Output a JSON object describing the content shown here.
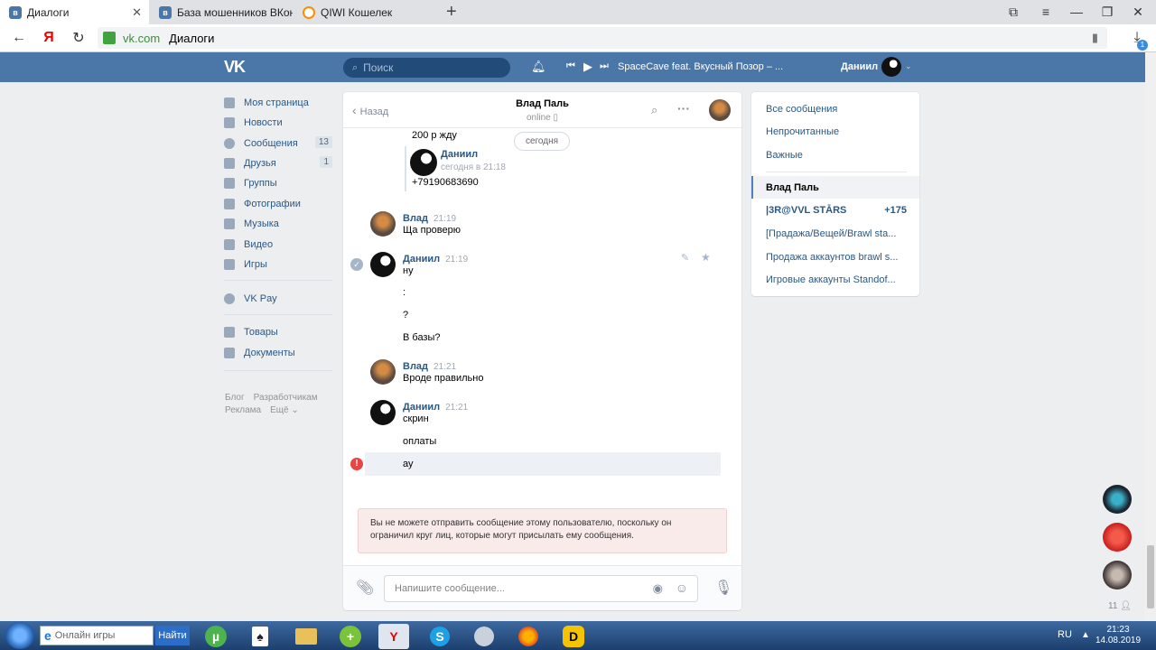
{
  "browser": {
    "tabs": [
      {
        "title": "Диалоги",
        "active": true,
        "favicon_color": "#4a76a8"
      },
      {
        "title": "База мошенников ВКонта",
        "active": false,
        "favicon_color": "#4a76a8"
      },
      {
        "title": "QIWI Кошелек",
        "active": false,
        "favicon_color": "#ff8c00"
      }
    ],
    "new_tab": "+",
    "url_host": "vk.com",
    "url_page": "Диалоги",
    "download_badge": "1"
  },
  "vk_header": {
    "logo": "VK",
    "search_placeholder": "Поиск",
    "now_playing": "SpaceCave feat. Вкусный Позор – ...",
    "user_name": "Даниил",
    "brand_color": "#4a76a8"
  },
  "left_menu": {
    "items": [
      {
        "label": "Моя страница",
        "icon": "home-icon",
        "count": ""
      },
      {
        "label": "Новости",
        "icon": "news-icon",
        "count": ""
      },
      {
        "label": "Сообщения",
        "icon": "messages-icon",
        "count": "13"
      },
      {
        "label": "Друзья",
        "icon": "friends-icon",
        "count": "1"
      },
      {
        "label": "Группы",
        "icon": "groups-icon",
        "count": ""
      },
      {
        "label": "Фотографии",
        "icon": "photos-icon",
        "count": ""
      },
      {
        "label": "Музыка",
        "icon": "music-icon",
        "count": ""
      },
      {
        "label": "Видео",
        "icon": "video-icon",
        "count": ""
      },
      {
        "label": "Игры",
        "icon": "games-icon",
        "count": ""
      }
    ],
    "vkpay": "VK Pay",
    "extra": [
      {
        "label": "Товары",
        "icon": "goods-icon"
      },
      {
        "label": "Документы",
        "icon": "documents-icon"
      }
    ],
    "footer": [
      "Блог",
      "Разработчикам",
      "Реклама",
      "Ещё ⌄"
    ]
  },
  "chat": {
    "back_label": "Назад",
    "peer_name": "Влад Паль",
    "peer_status": "online",
    "date_badge": "сегодня",
    "quoted_text": "200 р жду",
    "forwarded": {
      "name": "Даниил",
      "time": "сегодня в 21:18",
      "text": "+79190683690"
    },
    "groups": [
      {
        "name": "Влад",
        "time": "21:19",
        "lines": [
          "Ща проверю"
        ]
      },
      {
        "name": "Даниил",
        "time": "21:19",
        "lines": [
          "ну",
          ":",
          "?",
          "В базы?"
        ]
      },
      {
        "name": "Влад",
        "time": "21:21",
        "lines": [
          "Вроде правильно"
        ]
      },
      {
        "name": "Даниил",
        "time": "21:21",
        "lines": [
          "скрин",
          "оплаты",
          "ау"
        ]
      }
    ],
    "error_text": "Вы не можете отправить сообщение этому пользователю, поскольку он ограничил круг лиц, которые могут присылать ему сообщения.",
    "input_placeholder": "Напишите сообщение..."
  },
  "right_panel": {
    "filters": [
      "Все сообщения",
      "Непрочитанные",
      "Важные"
    ],
    "dialogs": [
      {
        "title": "Влад Паль",
        "count": "",
        "selected": true
      },
      {
        "title": "|3R@VVL STĀRS",
        "count": "+175",
        "selected": false
      },
      {
        "title": "[Прадажа/Вещей/Brawl sta...",
        "count": "",
        "selected": false
      },
      {
        "title": "Продажа аккаунтов brawl s...",
        "count": "",
        "selected": false
      },
      {
        "title": "Игровые аккаунты Standof...",
        "count": "",
        "selected": false
      }
    ]
  },
  "side_contacts": {
    "online_count": "11"
  },
  "taskbar": {
    "search_placeholder": "Онлайн игры",
    "search_button": "Найти",
    "lang": "RU",
    "time": "21:23",
    "date": "14.08.2019"
  }
}
